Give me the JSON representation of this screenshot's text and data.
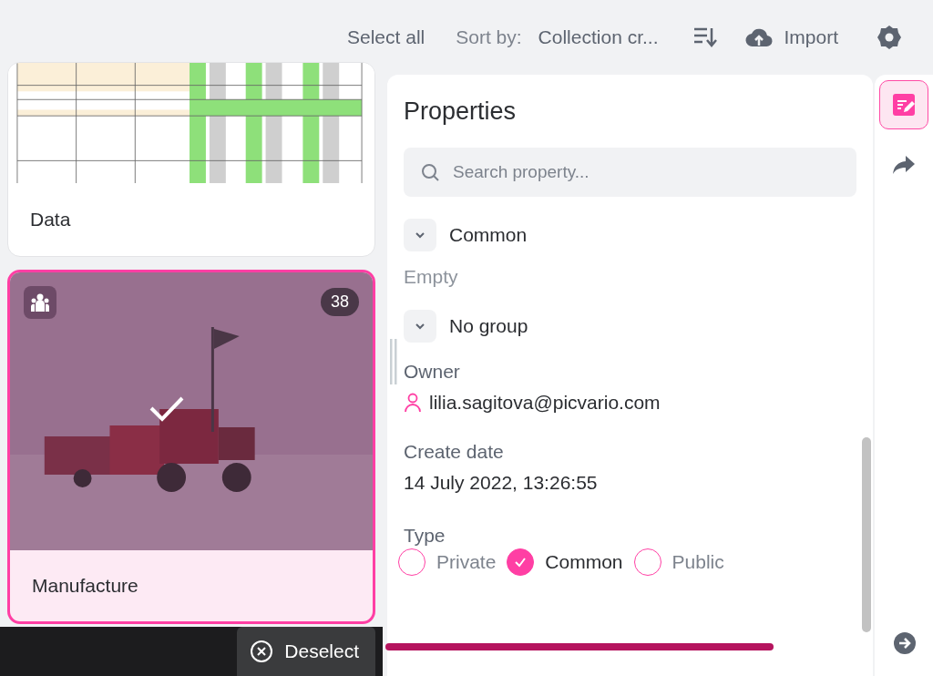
{
  "toolbar": {
    "select_all": "Select all",
    "sort_label": "Sort by:",
    "sort_value": "Collection cr...",
    "import": "Import"
  },
  "collections": [
    {
      "kind": "document",
      "title": "Data",
      "selected": false
    },
    {
      "title": "Manufacture",
      "selected": true,
      "count": "38"
    }
  ],
  "selection_bar": {
    "deselect": "Deselect"
  },
  "properties": {
    "title": "Properties",
    "search_placeholder": "Search property...",
    "groups": [
      {
        "name": "Common",
        "expanded": true,
        "fields": [
          {
            "kind": "empty",
            "value": "Empty"
          }
        ]
      },
      {
        "name": "No group",
        "expanded": true,
        "fields": [
          {
            "kind": "user",
            "label": "Owner",
            "value": "lilia.sagitova@picvario.com"
          },
          {
            "kind": "text",
            "label": "Create date",
            "value": "14 July 2022, 13:26:55"
          },
          {
            "kind": "radio",
            "label": "Type",
            "options": [
              {
                "label": "Private",
                "selected": false
              },
              {
                "label": "Common",
                "selected": true
              },
              {
                "label": "Public",
                "selected": false
              }
            ]
          }
        ]
      }
    ]
  },
  "rail": [
    {
      "kind": "edit",
      "selected": true
    },
    {
      "kind": "share",
      "selected": false
    }
  ]
}
